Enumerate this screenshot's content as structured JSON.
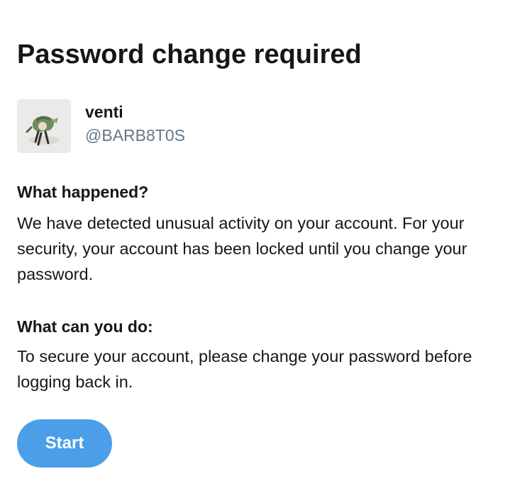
{
  "page": {
    "title": "Password change required"
  },
  "account": {
    "display_name": "venti",
    "handle": "@BARB8T0S"
  },
  "sections": [
    {
      "heading": "What happened?",
      "body": "We have detected unusual activity on your account. For your security, your account has been locked until you change your password."
    },
    {
      "heading": "What can you do:",
      "body": "To secure your account, please change your password before logging back in."
    }
  ],
  "actions": {
    "start_label": "Start"
  },
  "colors": {
    "accent": "#4a9fe8",
    "text_primary": "#14171a",
    "text_secondary": "#657786"
  }
}
